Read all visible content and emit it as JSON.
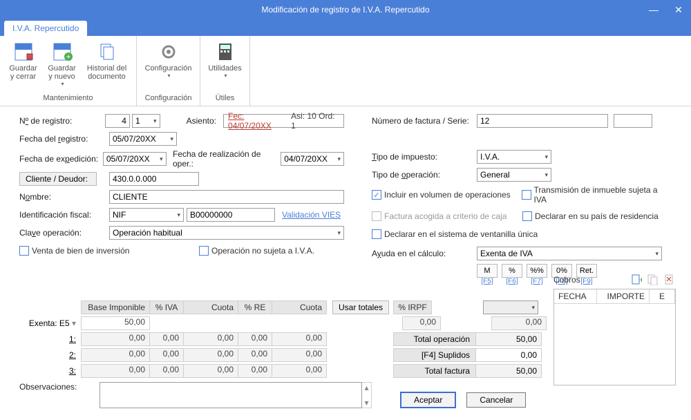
{
  "window": {
    "title": "Modificación de registro de I.V.A. Repercutido"
  },
  "tab": {
    "label": "I.V.A. Repercutido"
  },
  "ribbon": {
    "group_mant": "Mantenimiento",
    "group_conf": "Configuración",
    "group_util": "Útiles",
    "save_close": "Guardar\ny cerrar",
    "save_new": "Guardar\ny nuevo",
    "history": "Historial del\ndocumento",
    "config": "Configuración",
    "utilities": "Utilidades"
  },
  "left": {
    "nregistro_lbl_pre": "N",
    "nregistro_lbl_u": "º",
    "nregistro_lbl_post": " de registro:",
    "nregistro_v1": "4",
    "nregistro_v2": "1",
    "freg_lbl_pre": "Fecha del ",
    "freg_lbl_u": "r",
    "freg_lbl_post": "egistro:",
    "freg_val": "05/07/20XX",
    "fexp_lbl_pre": "Fecha de ex",
    "fexp_lbl_u": "p",
    "fexp_lbl_post": "edición:",
    "fexp_val": "05/07/20XX",
    "freal_lbl": "Fecha de realización de oper.:",
    "freal_val": "04/07/20XX",
    "asiento_lbl": "Asiento:",
    "asiento_fec": "Fec: 04/07/20XX",
    "asiento_asi": "Asi: 10 Ord: 1",
    "cliente_btn": "Cliente / Deudor:",
    "cliente_val": "430.0.0.000",
    "nombre_lbl_pre": "N",
    "nombre_lbl_u": "o",
    "nombre_lbl_post": "mbre:",
    "nombre_val": "CLIENTE",
    "idfis_lbl": "Identificación fiscal:",
    "idfis_tipo": "NIF",
    "idfis_num": "B00000000",
    "vies": "Validación VIES",
    "clave_lbl_pre": "Cla",
    "clave_lbl_u": "v",
    "clave_lbl_post": "e operación:",
    "clave_val": "Operación habitual",
    "venta_inv": "Venta de bien de inversión",
    "op_no_sujeta": "Operación no sujeta a I.V.A."
  },
  "right": {
    "numfac_lbl": "Número de factura / Serie:",
    "numfac_val": "12",
    "serie_val": "",
    "tipoimp_lbl_pre": "",
    "tipoimp_lbl_u": "T",
    "tipoimp_lbl_post": "ipo de impuesto:",
    "tipoimp_val": "I.V.A.",
    "tipoop_lbl_pre": "Tipo de ",
    "tipoop_lbl_u": "o",
    "tipoop_lbl_post": "peración:",
    "tipoop_val": "General",
    "incluir_vol": "Incluir en volumen de operaciones",
    "trans_inm": "Transmisión de inmueble sujeta a IVA",
    "criterio_caja": "Factura acogida a criterio de caja",
    "declarar_pais": "Declarar en su país de residencia",
    "ventanilla": "Declarar en el sistema de ventanilla única",
    "ayuda_lbl_pre": "A",
    "ayuda_lbl_u": "y",
    "ayuda_lbl_post": "uda en el cálculo:",
    "ayuda_val": "Exenta de IVA",
    "help_M": "M",
    "help_pct": "%",
    "help_pctpct": "%%",
    "help_0": "0%",
    "help_ret": "Ret.",
    "f5": "[F5]",
    "f6": "[F6]",
    "f7": "[F7]",
    "f8": "[F8]",
    "f9": "[F9]"
  },
  "grid": {
    "h_base": "Base Imponible",
    "h_piva": "% IVA",
    "h_cuota": "Cuota",
    "h_pre": "% RE",
    "h_cuota2": "Cuota",
    "usar_totales": "Usar totales",
    "h_pirpf": "% IRPF",
    "exenta_lbl": "Exenta: E5",
    "exenta_val": "50,00",
    "r1": "1:",
    "r2": "2:",
    "r3": "3:",
    "zero": "0,00",
    "col_irpf_val": "0,00",
    "col_ret_val": "0,00",
    "tot_op_lbl": "Total operación",
    "tot_op_val": "50,00",
    "sup_lbl": "[F4] Suplidos",
    "sup_val": "0,00",
    "tot_fac_lbl": "Total factura",
    "tot_fac_val": "50,00",
    "obs_lbl": "Observaciones:"
  },
  "cobros": {
    "title": "Cobros",
    "th_fecha": "FECHA",
    "th_importe": "IMPORTE",
    "th_e": "E"
  },
  "buttons": {
    "aceptar": "Aceptar",
    "cancelar": "Cancelar"
  }
}
